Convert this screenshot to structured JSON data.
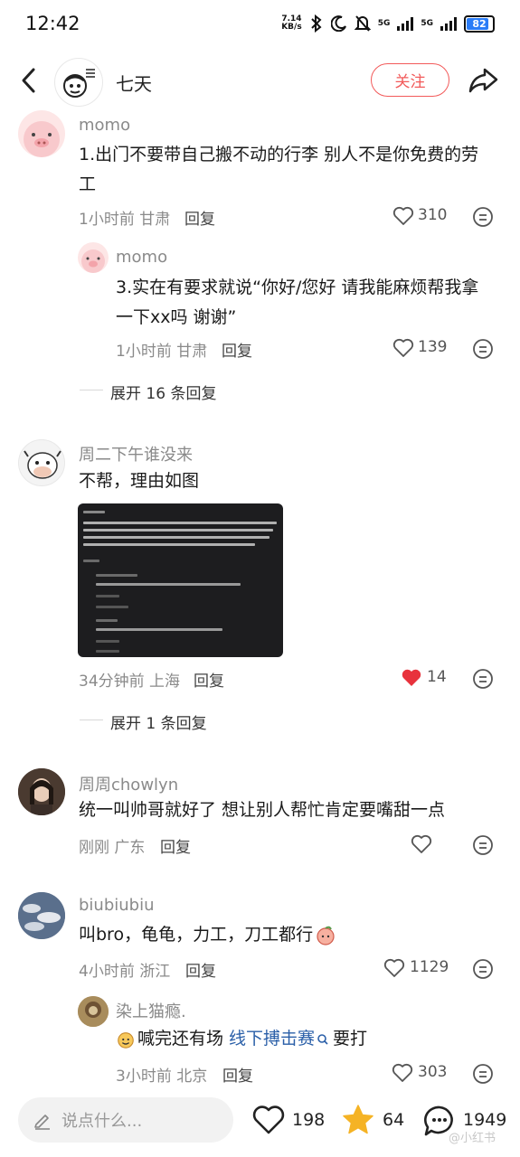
{
  "status_bar": {
    "time": "12:42",
    "net_speed_value": "7.14",
    "net_speed_unit": "KB/s",
    "signal1": "5G",
    "signal2": "5G",
    "battery": "82"
  },
  "header": {
    "user_name": "七天",
    "follow_label": "关注"
  },
  "comments": [
    {
      "user": "momo",
      "text_line1": "1.出门不要带自己搬不动的行李 别人不是你免费的劳",
      "text_line2": "工",
      "meta": "1小时前 甘肃",
      "reply_label": "回复",
      "likes": "310",
      "replies": [
        {
          "user": "momo",
          "text_line1": "3.实在有要求就说“你好/您好 请我能麻烦帮我拿",
          "text_line2": "一下xx吗 谢谢”",
          "meta": "1小时前 甘肃",
          "reply_label": "回复",
          "likes": "139"
        }
      ],
      "expand_label": "展开 16 条回复"
    },
    {
      "user": "周二下午谁没来",
      "text": "不帮，理由如图",
      "meta": "34分钟前 上海",
      "reply_label": "回复",
      "likes": "14",
      "liked": true,
      "expand_label": "展开 1 条回复"
    },
    {
      "user": "周周chowlyn",
      "text": "统一叫帅哥就好了 想让别人帮忙肯定要嘴甜一点",
      "meta": "刚刚 广东",
      "reply_label": "回复",
      "likes": ""
    },
    {
      "user": "biubiubiu",
      "text": "叫bro，龟龟，力工，刀工都行",
      "meta": "4小时前 浙江",
      "reply_label": "回复",
      "likes": "1129",
      "replies": [
        {
          "user": "染上猫瘾.",
          "text_before": "喊完还有场",
          "text_link": "线下搏击赛",
          "text_after": "要打",
          "meta": "3小时前 北京",
          "reply_label": "回复",
          "likes": "303"
        }
      ]
    }
  ],
  "bottom_bar": {
    "input_placeholder": "说点什么...",
    "likes": "198",
    "favorites": "64",
    "comments": "1949"
  },
  "colors": {
    "accent_red": "#f25a5a",
    "liked_red": "#e8323c",
    "star_gold": "#f5b325",
    "link_blue": "#2a5fa8"
  },
  "watermark": "@小红书"
}
